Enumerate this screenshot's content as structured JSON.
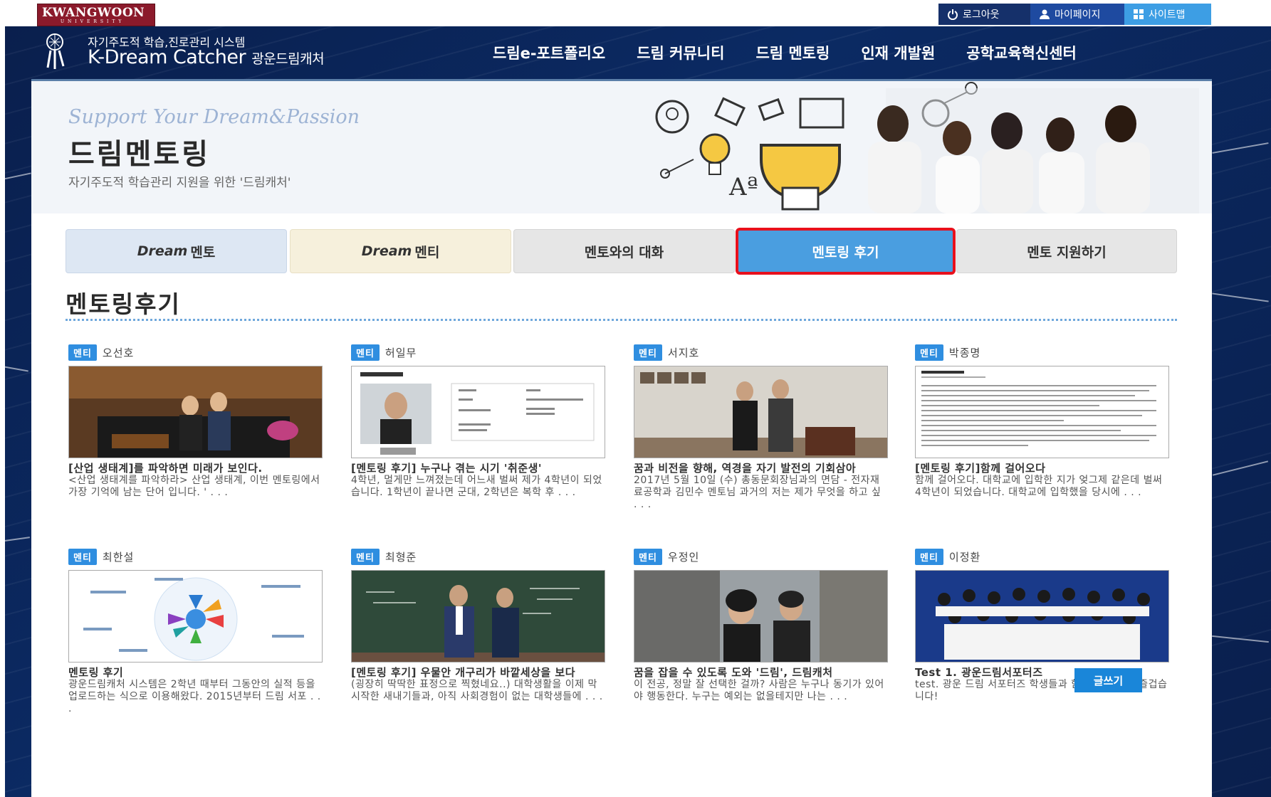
{
  "top_bar": {
    "university": "KWANGWOON",
    "university_sub": "UNIVERSITY",
    "login": "로그아웃",
    "mypage": "마이페이지",
    "sitemap": "사이트맵"
  },
  "header": {
    "logo_sub": "자기주도적 학습,진로관리 시스템",
    "logo_main": "K-Dream Catcher",
    "logo_main_ko": "광운드림캐처",
    "nav": [
      "드림e-포트폴리오",
      "드림 커뮤니티",
      "드림 멘토링",
      "인재 개발원",
      "공학교육혁신센터"
    ]
  },
  "hero": {
    "slogan": "Support Your Dream&Passion",
    "title": "드림멘토링",
    "desc": "자기주도적 학습관리 지원을 위한 '드림캐처'"
  },
  "tabs": [
    {
      "em": "Dream",
      "label": "멘토"
    },
    {
      "em": "Dream",
      "label": "멘티"
    },
    {
      "label": "멘토와의 대화"
    },
    {
      "label": "멘토링 후기",
      "active": true
    },
    {
      "label": "멘토 지원하기"
    }
  ],
  "section_title": "멘토링후기",
  "posts": [
    {
      "badge": "멘티",
      "author": "오선호",
      "title": "[산업 생태계]를 파악하면 미래가 보인다.",
      "excerpt": "<산업 생태계를 파악하라> 산업 생태계, 이번 멘토링에서 가장 기억에 남는 단어 입니다. ' . . ."
    },
    {
      "badge": "멘티",
      "author": "허일무",
      "title": "[멘토링 후기] 누구나 겪는 시기 '취준생'",
      "excerpt": "4학년, 멀게만 느껴졌는데 어느새 벌써 제가 4학년이 되었습니다. 1학년이 끝나면 군대, 2학년은 복학 후 . . ."
    },
    {
      "badge": "멘티",
      "author": "서지호",
      "title": "꿈과 비전을 향해, 역경을 자기 발전의 기회삼아",
      "excerpt": "2017년 5월 10일 (수) 총동문회장님과의 면담 - 전자재료공학과 김민수 멘토님 과거의 저는 제가 무엇을 하고 싶 . . ."
    },
    {
      "badge": "멘티",
      "author": "박종명",
      "title": "[멘토링 후기]함께 걸어오다",
      "excerpt": "함께 걸어오다. 대학교에 입학한 지가 엊그제 같은데 벌써 4학년이 되었습니다. 대학교에 입학했을 당시에 . . ."
    },
    {
      "badge": "멘티",
      "author": "최한설",
      "title": "멘토링 후기",
      "excerpt": "광운드림캐처 시스템은 2학년 때부터 그동안의 실적 등을 업로드하는 식으로 이용해왔다. 2015년부터 드림 서포 . . ."
    },
    {
      "badge": "멘티",
      "author": "최형준",
      "title": "[멘토링 후기] 우물안 개구리가 바깥세상을 보다",
      "excerpt": "(굉장히 딱딱한 표정으로 찍혔네요..) 대학생활을 이제 막 시작한 새내기들과, 아직 사회경험이 없는 대학생들에 . . ."
    },
    {
      "badge": "멘티",
      "author": "우정인",
      "title": "꿈을 잡을 수 있도록 도와 '드림', 드림캐처",
      "excerpt": "이 전공, 정말 잘 선택한 걸까? 사람은 누구나 동기가 있어야 행동한다. 누구는 예외는 없을테지만 나는 . . ."
    },
    {
      "badge": "멘티",
      "author": "이정환",
      "title": "Test 1. 광운드림서포터즈",
      "excerpt": "test. 광운 드림 서포터즈 학생들과 함께 여서 더욱 즐겁습니다!"
    }
  ],
  "write_button": "글쓰기",
  "colors": {
    "accent": "#4a9ee0",
    "badge": "#2f8ee0",
    "highlight": "#e8101c",
    "header_bg": "#0b2a63"
  }
}
